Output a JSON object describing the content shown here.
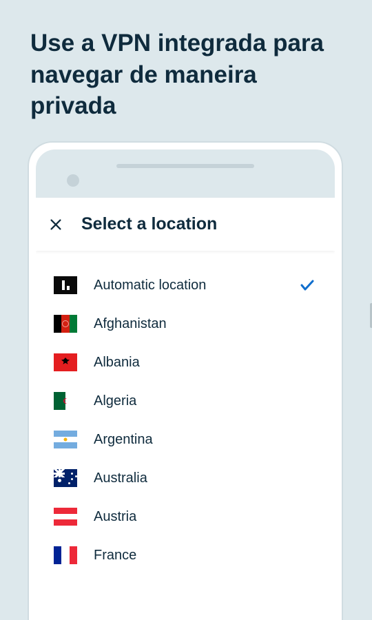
{
  "headline": "Use a VPN integrada para navegar de maneira privada",
  "sheet": {
    "title": "Select a location"
  },
  "locations": [
    {
      "label": "Automatic location",
      "flag": "auto",
      "selected": true
    },
    {
      "label": "Afghanistan",
      "flag": "afghanistan",
      "selected": false
    },
    {
      "label": "Albania",
      "flag": "albania",
      "selected": false
    },
    {
      "label": "Algeria",
      "flag": "algeria",
      "selected": false
    },
    {
      "label": "Argentina",
      "flag": "argentina",
      "selected": false
    },
    {
      "label": "Australia",
      "flag": "australia",
      "selected": false
    },
    {
      "label": "Austria",
      "flag": "austria",
      "selected": false
    },
    {
      "label": "France",
      "flag": "france",
      "selected": false
    }
  ],
  "colors": {
    "background": "#dde8ec",
    "text": "#0f2b3d",
    "accent": "#0f6ecd"
  }
}
